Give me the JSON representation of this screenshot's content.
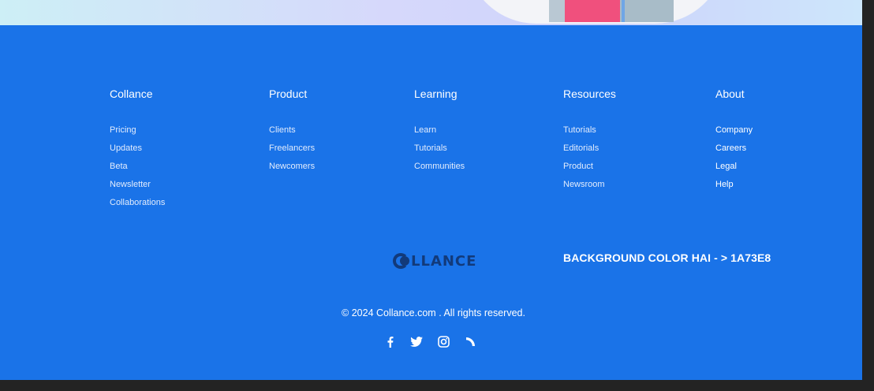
{
  "columns": [
    {
      "title": "Collance",
      "links": [
        "Pricing",
        "Updates",
        "Beta",
        "Newsletter",
        "Collaborations"
      ]
    },
    {
      "title": "Product",
      "links": [
        "Clients",
        "Freelancers",
        "Newcomers"
      ]
    },
    {
      "title": "Learning",
      "links": [
        "Learn",
        "Tutorials",
        "Communities"
      ]
    },
    {
      "title": "Resources",
      "links": [
        "Tutorials",
        "Editorials",
        "Product",
        "Newsroom"
      ]
    },
    {
      "title": "About",
      "links": [
        "Company",
        "Careers",
        "Legal",
        "Help"
      ]
    }
  ],
  "logo": {
    "text": "LLANCE"
  },
  "note": "BACKGROUND COLOR HAI - > 1A73E8",
  "copyright": "© 2024  Collance.com . All rights reserved.",
  "social": [
    "facebook-icon",
    "twitter-icon",
    "instagram-icon",
    "feed-icon"
  ],
  "colors": {
    "footer_bg": "#1A73E8",
    "logo": "#123A7A"
  }
}
